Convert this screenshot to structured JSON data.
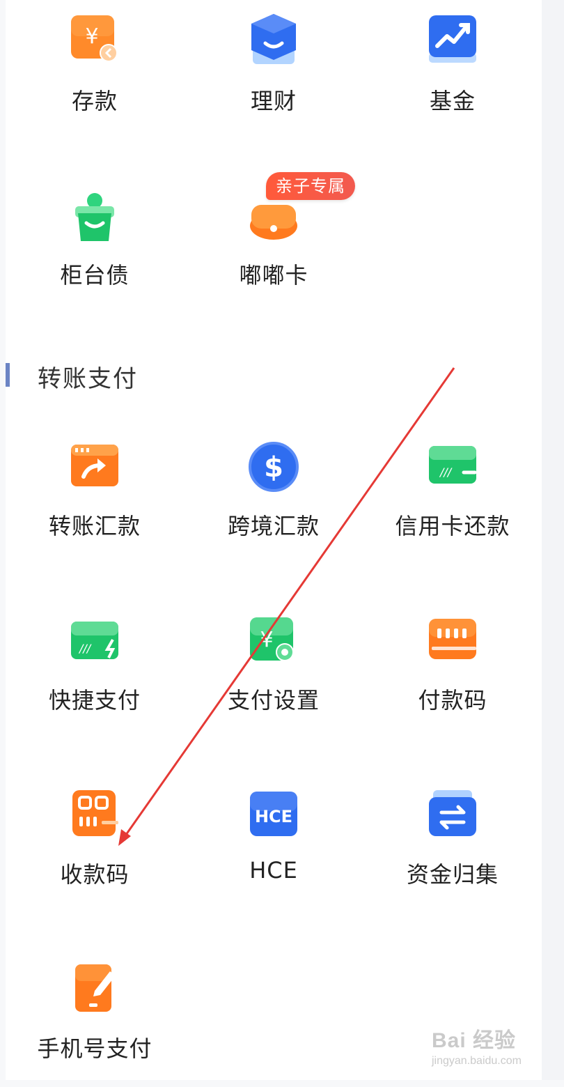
{
  "section": {
    "title": "转账支付"
  },
  "top_items": [
    {
      "label": "存款",
      "icon": "deposit-yuan-icon"
    },
    {
      "label": "理财",
      "icon": "wealth-management-icon"
    },
    {
      "label": "基金",
      "icon": "fund-chart-icon"
    },
    {
      "label": "柜台债",
      "icon": "counter-bond-icon"
    },
    {
      "label": "嘟嘟卡",
      "icon": "dudu-card-icon",
      "badge": "亲子专属"
    }
  ],
  "transfer_items": [
    {
      "label": "转账汇款",
      "icon": "transfer-icon"
    },
    {
      "label": "跨境汇款",
      "icon": "cross-border-dollar-icon"
    },
    {
      "label": "信用卡还款",
      "icon": "credit-card-repay-icon"
    },
    {
      "label": "快捷支付",
      "icon": "quick-pay-card-icon"
    },
    {
      "label": "支付设置",
      "icon": "payment-settings-icon"
    },
    {
      "label": "付款码",
      "icon": "payment-code-icon"
    },
    {
      "label": "收款码",
      "icon": "receive-code-icon"
    },
    {
      "label": "HCE",
      "icon": "hce-icon"
    },
    {
      "label": "资金归集",
      "icon": "fund-pooling-icon"
    },
    {
      "label": "手机号支付",
      "icon": "phone-number-pay-icon"
    }
  ],
  "watermark": {
    "brand": "Bai 经验",
    "url": "jingyan.baidu.com"
  },
  "colors": {
    "orange": "#ff7a1e",
    "blue": "#2f6df0",
    "green": "#1fc46a",
    "badge": "#f25a4f",
    "annotation_arrow": "#e53935",
    "section_bar": "#6b84c4"
  }
}
